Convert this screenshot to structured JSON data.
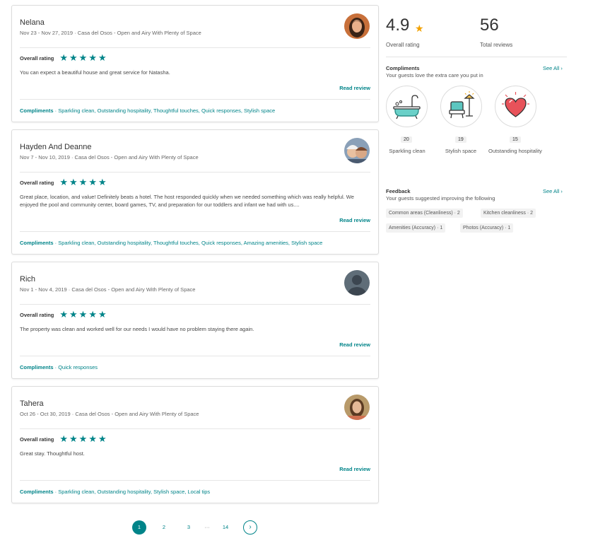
{
  "reviews": [
    {
      "name": "Nelana",
      "meta": "Nov 23 - Nov 27, 2019 · Casa del Osos - Open and Airy With Plenty of Space",
      "rating_label": "Overall rating",
      "stars": 5,
      "text": "You can expect a beautiful house and great service for Natasha.",
      "read_label": "Read review",
      "compliments_label": "Compliments",
      "compliments": "· Sparkling clean, Outstanding hospitality, Thoughtful touches, Quick responses, Stylish space",
      "avatar": "woman-dark-hair"
    },
    {
      "name": "Hayden And Deanne",
      "meta": "Nov 7 - Nov 10, 2019 · Casa del Osos - Open and Airy With Plenty of Space",
      "rating_label": "Overall rating",
      "stars": 5,
      "text": "Great place, location, and value! Definitely beats a hotel. The host responded quickly when we needed something which was really helpful. We enjoyed the pool and community center, board games, TV, and preparation for our toddlers and infant we had with us....",
      "read_label": "Read review",
      "compliments_label": "Compliments",
      "compliments": "· Sparkling clean, Outstanding hospitality, Thoughtful touches, Quick responses, Amazing amenities, Stylish space",
      "avatar": "couple-cap"
    },
    {
      "name": "Rich",
      "meta": "Nov 1 - Nov 4, 2019 · Casa del Osos - Open and Airy With Plenty of Space",
      "rating_label": "Overall rating",
      "stars": 5,
      "text": "The property was clean and worked well for our needs I would have no problem staying there again.",
      "read_label": "Read review",
      "compliments_label": "Compliments",
      "compliments": "· Quick responses",
      "avatar": "default-silhouette"
    },
    {
      "name": "Tahera",
      "meta": "Oct 26 - Oct 30, 2019 · Casa del Osos - Open and Airy With Plenty of Space",
      "rating_label": "Overall rating",
      "stars": 5,
      "text": "Great stay. Thoughtful host.",
      "read_label": "Read review",
      "compliments_label": "Compliments",
      "compliments": "· Sparkling clean, Outstanding hospitality, Stylish space, Local tips",
      "avatar": "woman-light"
    }
  ],
  "summary": {
    "rating": "4.9",
    "rating_label": "Overall rating",
    "total": "56",
    "total_label": "Total reviews"
  },
  "compliments_section": {
    "title": "Compliments",
    "subtitle": "Your guests love the extra care you put in",
    "see_all": "See All ›",
    "badges": [
      {
        "count": "20",
        "label": "Sparkling clean",
        "icon": "bathtub-icon"
      },
      {
        "count": "19",
        "label": "Stylish space",
        "icon": "lamp-chair-icon"
      },
      {
        "count": "15",
        "label": "Outstanding hospitality",
        "icon": "heart-icon"
      }
    ]
  },
  "feedback_section": {
    "title": "Feedback",
    "subtitle": "Your guests suggested improving the following",
    "see_all": "See All ›",
    "chips": [
      "Common areas (Cleanliness) · 2",
      "Kitchen cleanliness · 2",
      "Amenities (Accuracy) · 1",
      "Photos (Accuracy) · 1"
    ]
  },
  "pagination": {
    "pages": [
      "1",
      "2",
      "3",
      "···",
      "14"
    ],
    "current": "1",
    "next_label": "›"
  },
  "colors": {
    "accent": "#008489",
    "star_gold": "#f2a100"
  }
}
